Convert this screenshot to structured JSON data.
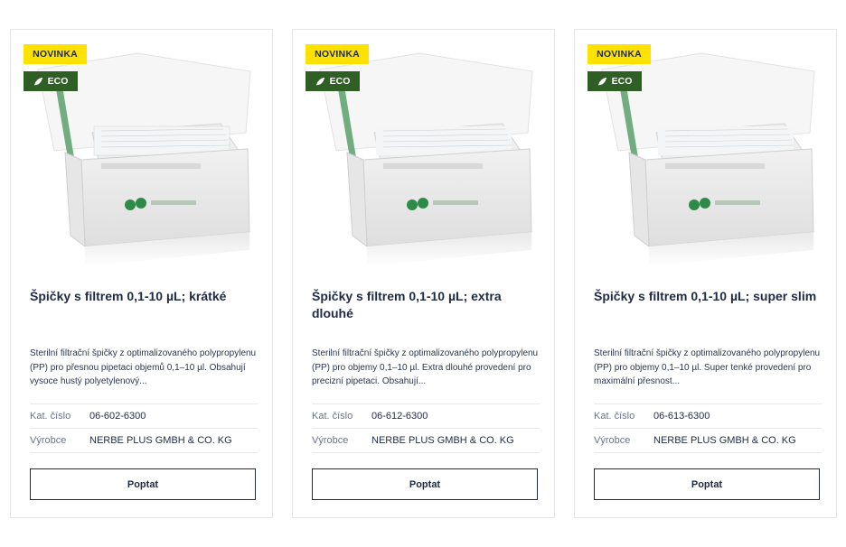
{
  "products": [
    {
      "badge_new": "NOVINKA",
      "badge_eco": "ECO",
      "title": "Špičky s filtrem 0,1-10 µL; krátké",
      "description": "Sterilní filtrační špičky z optimalizovaného polypropylenu (PP) pro přesnou pipetaci objemů 0,1–10 µl. Obsahují vysoce hustý polyetylenový...",
      "cat_label": "Kat. číslo",
      "cat_value": "06-602-6300",
      "maker_label": "Výrobce",
      "maker_value": "NERBE PLUS GMBH & CO. KG",
      "button": "Poptat"
    },
    {
      "badge_new": "NOVINKA",
      "badge_eco": "ECO",
      "title": "Špičky s filtrem 0,1-10 µL; extra dlouhé",
      "description": "Sterilní filtrační špičky z optimalizovaného polypropylenu (PP) pro objemy 0,1–10 µl. Extra dlouhé provedení pro precizní pipetaci. Obsahují...",
      "cat_label": "Kat. číslo",
      "cat_value": "06-612-6300",
      "maker_label": "Výrobce",
      "maker_value": "NERBE PLUS GMBH & CO. KG",
      "button": "Poptat"
    },
    {
      "badge_new": "NOVINKA",
      "badge_eco": "ECO",
      "title": "Špičky s filtrem 0,1-10 µL; super slim",
      "description": "Sterilní filtrační špičky z optimalizovaného polypropylenu (PP) pro objemy 0,1–10 µl. Super tenké provedení pro maximální přesnost...",
      "cat_label": "Kat. číslo",
      "cat_value": "06-613-6300",
      "maker_label": "Výrobce",
      "maker_value": "NERBE PLUS GMBH & CO. KG",
      "button": "Poptat"
    }
  ],
  "colors": {
    "badge_new_bg": "#ffe100",
    "badge_eco_bg": "#2f5f25",
    "text_primary": "#1f2a44",
    "border": "#e4e6ea"
  },
  "icons": {
    "eco": "leaf-icon"
  }
}
